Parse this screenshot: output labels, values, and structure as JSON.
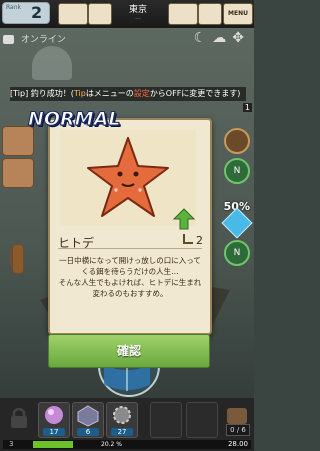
{
  "header": {
    "rank_label": "Rank",
    "rank_value": "2",
    "location": "東京",
    "location_dots": "...",
    "buttons": [
      "",
      "",
      "MENU"
    ],
    "online_label": "オンライン"
  },
  "tip": {
    "prefix": "[Tip] 釣り成功！(",
    "tip_word": "Tip",
    "middle": "はメニューの",
    "settings_word": "設定",
    "suffix": "からOFFに変更できます)"
  },
  "side": {
    "right_count": "1",
    "percent": "50%",
    "badges": [
      "N",
      "N"
    ]
  },
  "modal": {
    "rarity": "NORMAL",
    "fish_name": "ヒトデ",
    "level": "2",
    "description_lines": [
      "一日中横になって開けっ放しの口に入って",
      "くる餌を待らうだけの人生…",
      "そんな人生でもよければ、ヒトデに生まれ",
      "変わるのもおすすめ。"
    ],
    "confirm_label": "確認"
  },
  "bottom": {
    "slots": [
      {
        "count": "17"
      },
      {
        "count": "6"
      },
      {
        "count": "27"
      },
      {
        "count": ""
      },
      {
        "count": ""
      }
    ],
    "level_label": "3",
    "xp_percent_text": "20.2 %",
    "xp_fraction": 0.202,
    "xp_total": "28.00",
    "bag_counter": "0 / 6"
  },
  "colors": {
    "accent_green": "#7cbb45",
    "rarity_blue": "#1a2a6a",
    "starfish_orange": "#e36b3c"
  }
}
